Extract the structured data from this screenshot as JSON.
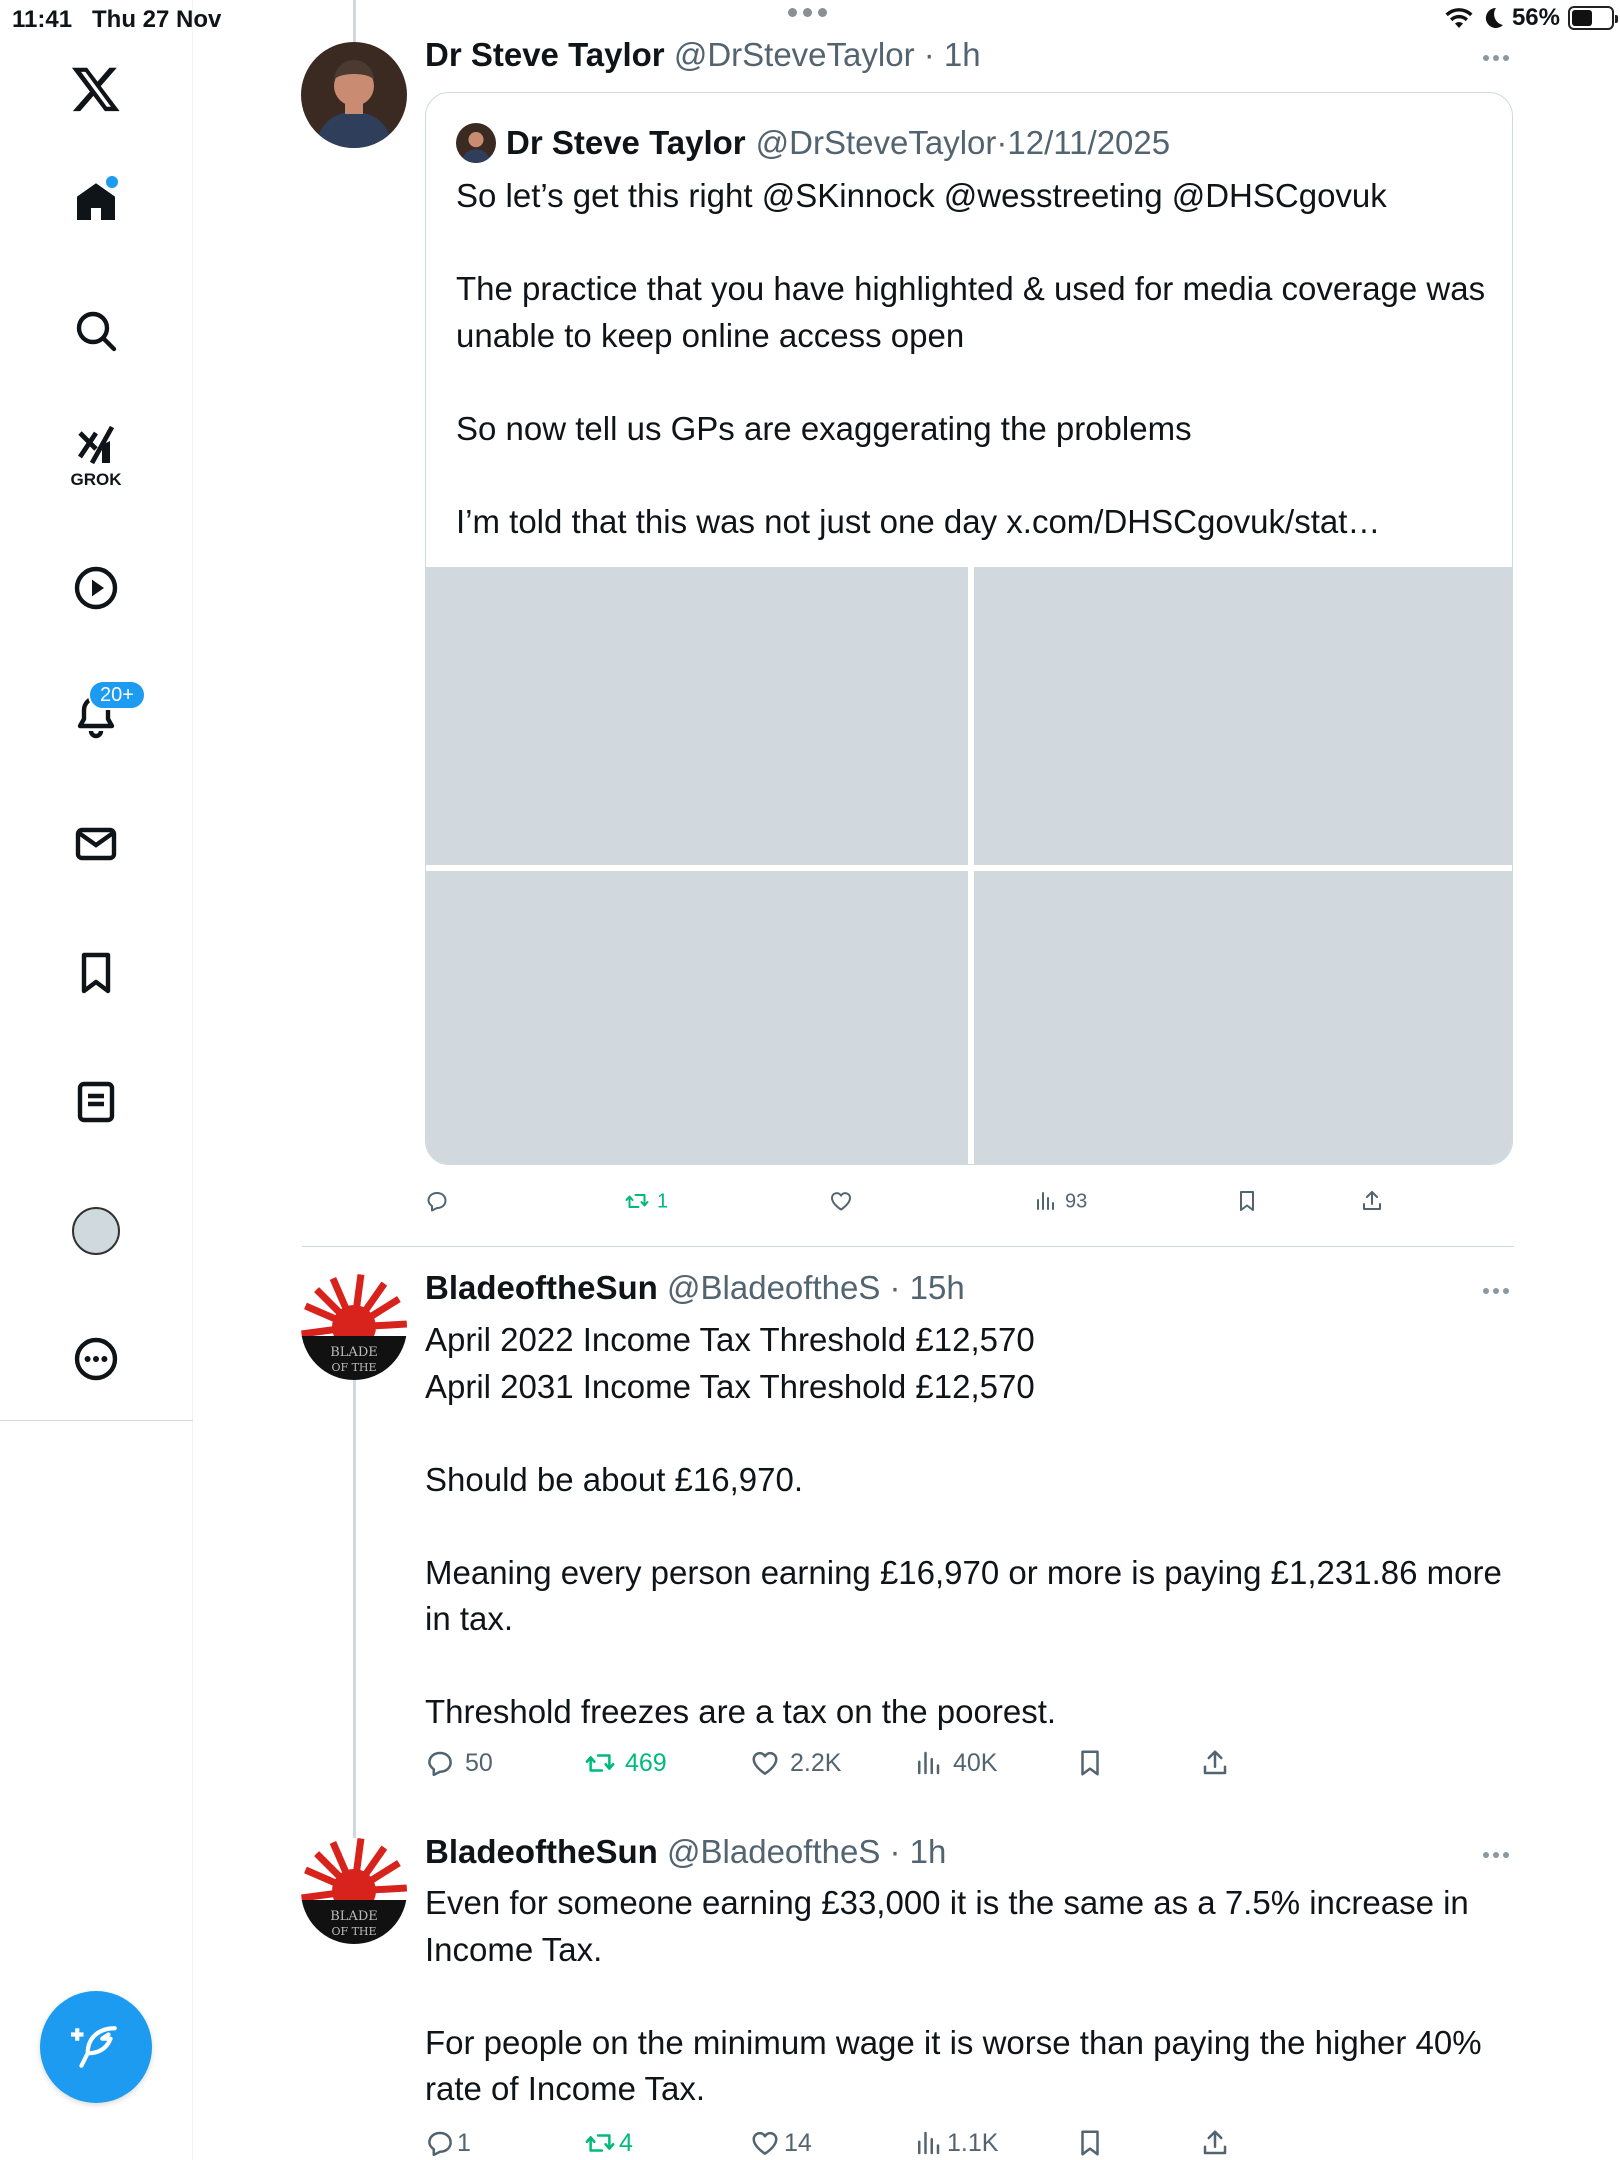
{
  "status_bar": {
    "time": "11:41",
    "date": "Thu 27 Nov",
    "battery": "56%",
    "battery_level": 0.56
  },
  "sidebar": {
    "items": [
      {
        "name": "x-logo-icon",
        "label": ""
      },
      {
        "name": "home-icon",
        "label": ""
      },
      {
        "name": "search-icon",
        "label": ""
      },
      {
        "name": "grok-icon",
        "label": "GROK"
      },
      {
        "name": "video-icon",
        "label": ""
      },
      {
        "name": "notifications-icon",
        "label": "",
        "badge": "20+"
      },
      {
        "name": "messages-icon",
        "label": ""
      },
      {
        "name": "bookmarks-icon",
        "label": ""
      },
      {
        "name": "lists-icon",
        "label": ""
      },
      {
        "name": "profile-icon",
        "label": ""
      },
      {
        "name": "more-icon",
        "label": ""
      }
    ],
    "compose_icon": "compose-feather-icon"
  },
  "tweets": [
    {
      "name": "Dr Steve Taylor",
      "handle": "@DrSteveTaylor",
      "time": "1h",
      "quote": {
        "name": "Dr Steve Taylor",
        "handle": "@DrSteveTaylor",
        "date": "12/11/2025",
        "text": "So let’s get this right @SKinnock @wesstreeting @DHSCgovuk\n\nThe practice that you have highlighted & used for media coverage was unable to keep online access open\n\nSo now tell us GPs are exaggerating the problems\n\nI’m told that this was not just one day x.com/DHSCgovuk/stat…"
      },
      "actions": {
        "replies": "",
        "reposts": "1",
        "likes": "",
        "views": "93"
      }
    },
    {
      "name": "BladeoftheSun",
      "handle": "@BladeoftheS",
      "time": "15h",
      "text": "April 2022 Income Tax Threshold £12,570\nApril 2031 Income Tax Threshold £12,570\n\nShould be about £16,970.\n\nMeaning every person earning £16,970 or more is paying £1,231.86 more in tax.\n\nThreshold freezes are a tax on the poorest.",
      "actions": {
        "replies": "50",
        "reposts": "469",
        "likes": "2.2K",
        "views": "40K"
      }
    },
    {
      "name": "BladeoftheSun",
      "handle": "@BladeoftheS",
      "time": "1h",
      "text": "Even for someone earning £33,000 it is the same as a 7.5% increase in Income Tax.\n\nFor people on the minimum wage it is worse than paying the higher 40% rate of Income Tax.",
      "actions": {
        "replies": "1",
        "reposts": "4",
        "likes": "14",
        "views": "1.1K"
      }
    }
  ],
  "colors": {
    "accent": "#1d9bf0",
    "repost": "#00ba7c",
    "muted": "#536471",
    "media_placeholder": "#d1d9df"
  }
}
